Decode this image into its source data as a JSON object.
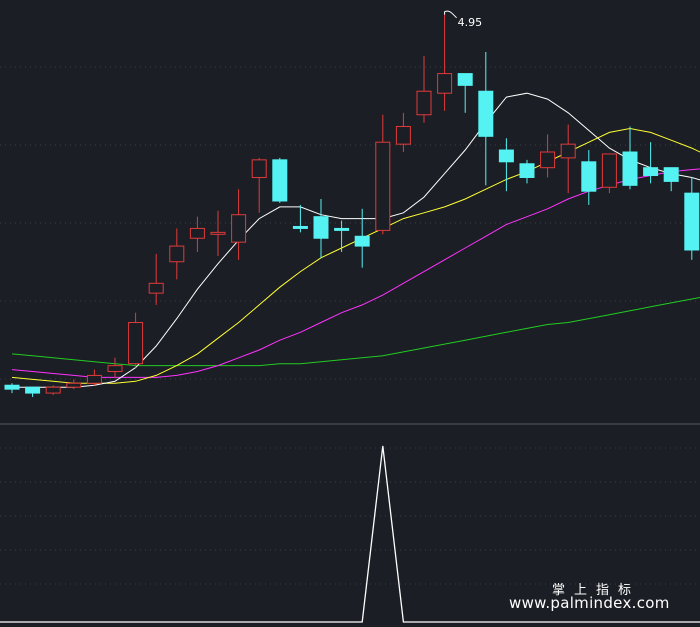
{
  "chart_data": {
    "type": "candlestick",
    "title": "",
    "high_marker_label": "4.95",
    "colors": {
      "up": "#e03a3a",
      "down": "#54f2f2",
      "ma5": "#ffffff",
      "ma10": "#ffff33",
      "ma20": "#ff33ff",
      "ma60": "#22cc22",
      "indicator": "#ffffff",
      "background": "#1b1e24",
      "grid": "#3a3f4a"
    },
    "price_range": [
      3.0,
      5.0
    ],
    "candles": [
      {
        "o": 3.06,
        "h": 3.07,
        "l": 3.02,
        "c": 3.04
      },
      {
        "o": 3.05,
        "h": 3.05,
        "l": 3.0,
        "c": 3.02
      },
      {
        "o": 3.02,
        "h": 3.06,
        "l": 3.01,
        "c": 3.05
      },
      {
        "o": 3.05,
        "h": 3.09,
        "l": 3.04,
        "c": 3.07
      },
      {
        "o": 3.07,
        "h": 3.14,
        "l": 3.06,
        "c": 3.11
      },
      {
        "o": 3.13,
        "h": 3.2,
        "l": 3.1,
        "c": 3.16
      },
      {
        "o": 3.17,
        "h": 3.43,
        "l": 3.15,
        "c": 3.38
      },
      {
        "o": 3.53,
        "h": 3.73,
        "l": 3.47,
        "c": 3.58
      },
      {
        "o": 3.69,
        "h": 3.86,
        "l": 3.6,
        "c": 3.77
      },
      {
        "o": 3.81,
        "h": 3.92,
        "l": 3.74,
        "c": 3.86
      },
      {
        "o": 3.83,
        "h": 3.95,
        "l": 3.72,
        "c": 3.84
      },
      {
        "o": 3.79,
        "h": 4.06,
        "l": 3.7,
        "c": 3.93
      },
      {
        "o": 4.12,
        "h": 4.22,
        "l": 3.94,
        "c": 4.21
      },
      {
        "o": 4.21,
        "h": 4.22,
        "l": 3.99,
        "c": 4.0
      },
      {
        "o": 3.87,
        "h": 3.98,
        "l": 3.84,
        "c": 3.86
      },
      {
        "o": 3.92,
        "h": 4.01,
        "l": 3.71,
        "c": 3.81
      },
      {
        "o": 3.86,
        "h": 3.9,
        "l": 3.74,
        "c": 3.85
      },
      {
        "o": 3.82,
        "h": 3.96,
        "l": 3.66,
        "c": 3.77
      },
      {
        "o": 3.85,
        "h": 4.44,
        "l": 3.83,
        "c": 4.3
      },
      {
        "o": 4.29,
        "h": 4.45,
        "l": 4.25,
        "c": 4.38
      },
      {
        "o": 4.44,
        "h": 4.74,
        "l": 4.4,
        "c": 4.56
      },
      {
        "o": 4.55,
        "h": 4.95,
        "l": 4.46,
        "c": 4.65
      },
      {
        "o": 4.65,
        "h": 4.63,
        "l": 4.45,
        "c": 4.59
      },
      {
        "o": 4.56,
        "h": 4.76,
        "l": 4.08,
        "c": 4.33
      },
      {
        "o": 4.26,
        "h": 4.32,
        "l": 4.05,
        "c": 4.2
      },
      {
        "o": 4.19,
        "h": 4.21,
        "l": 4.09,
        "c": 4.12
      },
      {
        "o": 4.17,
        "h": 4.34,
        "l": 4.12,
        "c": 4.25
      },
      {
        "o": 4.22,
        "h": 4.39,
        "l": 4.04,
        "c": 4.29
      },
      {
        "o": 4.2,
        "h": 4.26,
        "l": 3.98,
        "c": 4.05
      },
      {
        "o": 4.07,
        "h": 4.24,
        "l": 4.04,
        "c": 4.24
      },
      {
        "o": 4.25,
        "h": 4.38,
        "l": 4.06,
        "c": 4.08
      },
      {
        "o": 4.17,
        "h": 4.3,
        "l": 4.09,
        "c": 4.13
      },
      {
        "o": 4.17,
        "h": 4.17,
        "l": 4.05,
        "c": 4.1
      },
      {
        "o": 4.04,
        "h": 4.12,
        "l": 3.7,
        "c": 3.75
      },
      {
        "o": 3.77,
        "h": 3.86,
        "l": 3.65,
        "c": 3.82
      },
      {
        "o": 3.84,
        "h": 4.14,
        "l": 3.6,
        "c": 3.7
      }
    ],
    "ma5": [
      3.05,
      3.05,
      3.05,
      3.05,
      3.06,
      3.08,
      3.15,
      3.26,
      3.4,
      3.55,
      3.68,
      3.8,
      3.91,
      3.97,
      3.97,
      3.93,
      3.91,
      3.91,
      3.91,
      3.94,
      4.02,
      4.14,
      4.26,
      4.4,
      4.53,
      4.55,
      4.52,
      4.45,
      4.36,
      4.27,
      4.21,
      4.17,
      4.14,
      4.12,
      4.09,
      4.06
    ],
    "ma10": [
      3.1,
      3.09,
      3.08,
      3.07,
      3.07,
      3.07,
      3.08,
      3.11,
      3.16,
      3.22,
      3.3,
      3.38,
      3.47,
      3.56,
      3.64,
      3.71,
      3.76,
      3.81,
      3.86,
      3.91,
      3.94,
      3.97,
      4.01,
      4.06,
      4.11,
      4.15,
      4.2,
      4.25,
      4.3,
      4.35,
      4.37,
      4.35,
      4.31,
      4.27,
      4.22,
      4.18
    ],
    "ma20": [
      3.14,
      3.13,
      3.12,
      3.11,
      3.1,
      3.1,
      3.1,
      3.1,
      3.11,
      3.13,
      3.16,
      3.2,
      3.24,
      3.29,
      3.33,
      3.38,
      3.43,
      3.47,
      3.52,
      3.58,
      3.64,
      3.7,
      3.76,
      3.82,
      3.88,
      3.92,
      3.96,
      4.01,
      4.05,
      4.08,
      4.11,
      4.13,
      4.15,
      4.16,
      4.17,
      4.17
    ],
    "ma60": [
      3.22,
      3.21,
      3.2,
      3.19,
      3.18,
      3.17,
      3.16,
      3.16,
      3.16,
      3.16,
      3.16,
      3.16,
      3.16,
      3.17,
      3.17,
      3.18,
      3.19,
      3.2,
      3.21,
      3.23,
      3.25,
      3.27,
      3.29,
      3.31,
      3.33,
      3.35,
      3.37,
      3.38,
      3.4,
      3.42,
      3.44,
      3.46,
      3.48,
      3.5,
      3.52,
      3.54
    ],
    "indicator": {
      "values": [
        0,
        0,
        0,
        0,
        0,
        0,
        0,
        0,
        0,
        0,
        0,
        0,
        0,
        0,
        0,
        0,
        0,
        0,
        1,
        0,
        0,
        0,
        0,
        0,
        0,
        0,
        0,
        0,
        0,
        0,
        0,
        0,
        0,
        0,
        0,
        0
      ],
      "range": [
        0,
        1
      ]
    }
  },
  "watermark": {
    "cn": "掌上指标",
    "url": "www.palmindex.com"
  }
}
